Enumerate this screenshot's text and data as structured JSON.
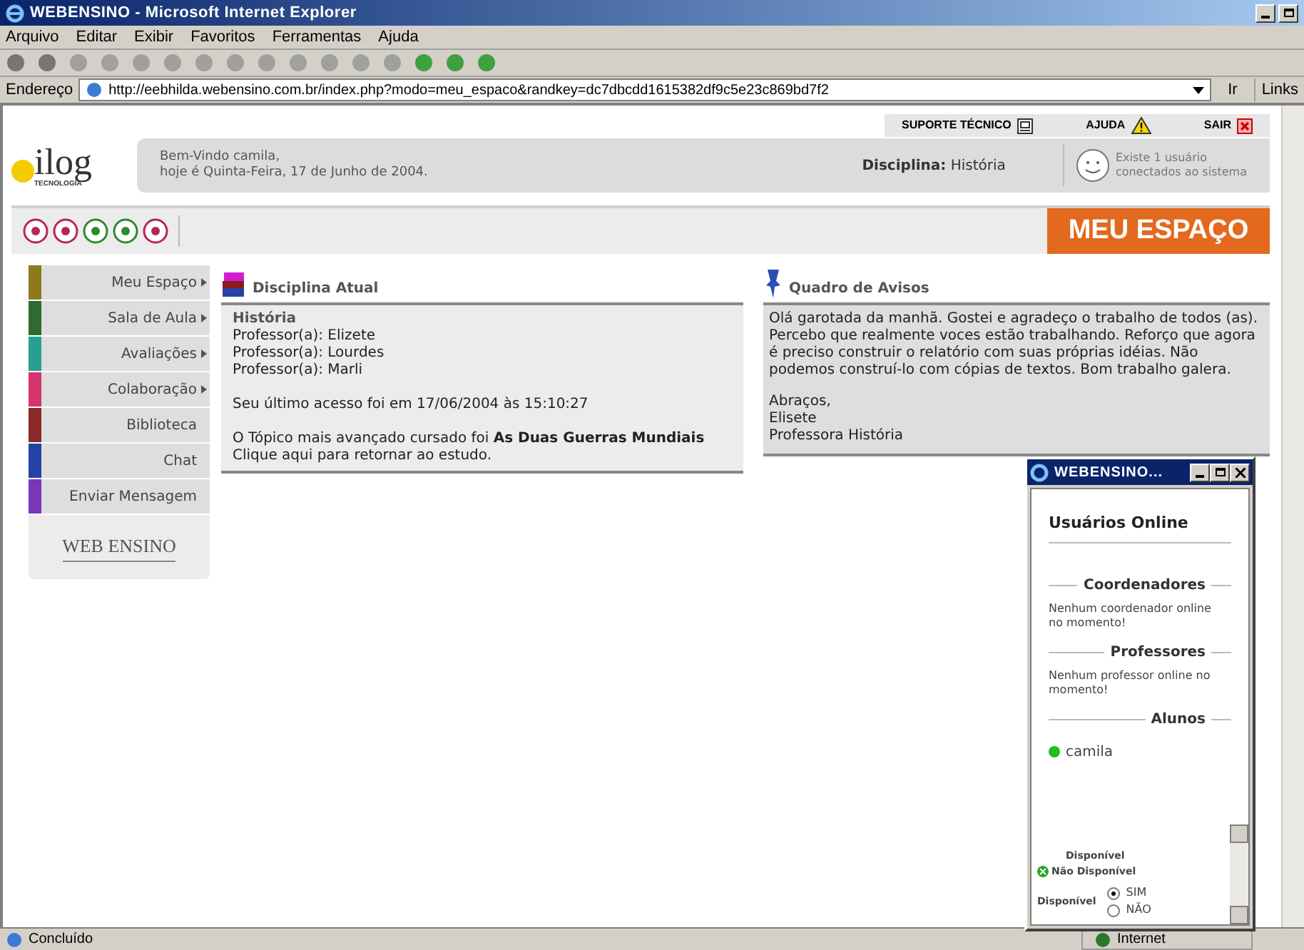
{
  "window": {
    "title": "WEBENSINO - Microsoft Internet Explorer"
  },
  "menu_bar": [
    "Arquivo",
    "Editar",
    "Exibir",
    "Favoritos",
    "Ferramentas",
    "Ajuda"
  ],
  "address_bar": {
    "label": "Endereço",
    "url": "http://eebhilda.webensino.com.br/index.php?modo=meu_espaco&randkey=dc7dbcdd1615382df9c5e23c869bd7f2",
    "go": "Ir",
    "links": "Links"
  },
  "top_links": [
    {
      "label": "SUPORTE TÉCNICO",
      "kind": "monitor"
    },
    {
      "label": "AJUDA",
      "kind": "warning"
    },
    {
      "label": "SAIR",
      "kind": "close"
    }
  ],
  "header": {
    "logo": "ilog",
    "logo_sub": "TECNOLOGIA",
    "welcome": "Bem-Vindo camila,",
    "date": "hoje é Quinta-Feira, 17 de Junho de 2004.",
    "discipline_label": "Disciplina:",
    "discipline_value": "História",
    "users_line1": "Existe 1 usuário",
    "users_line2": "conectados ao sistema"
  },
  "page_title": "MEU ESPAÇO",
  "sidebar": {
    "items": [
      {
        "label": "Meu Espaço",
        "color": "#8b7a1e",
        "submenu": true
      },
      {
        "label": "Sala de Aula",
        "color": "#2f6b2f",
        "submenu": true
      },
      {
        "label": "Avaliações",
        "color": "#27a093",
        "submenu": true
      },
      {
        "label": "Colaboração",
        "color": "#d6336f",
        "submenu": true
      },
      {
        "label": "Biblioteca",
        "color": "#8b2a2a",
        "submenu": false
      },
      {
        "label": "Chat",
        "color": "#2343a6",
        "submenu": false
      },
      {
        "label": "Enviar Mensagem",
        "color": "#7a35b8",
        "submenu": false
      }
    ],
    "brand": "WEB ENSINO"
  },
  "disciplina": {
    "title": "Disciplina Atual",
    "subject": "História",
    "professors": [
      "Professor(a): Elizete",
      "Professor(a): Lourdes",
      "Professor(a): Marli"
    ],
    "last_access": "Seu último acesso foi em 17/06/2004 às 15:10:27",
    "topic": "O Tópico mais avançado cursado foi **As Duas Guerras Mundiais**",
    "return_link": "Clique aqui para retornar ao estudo."
  },
  "avisos": {
    "title": "Quadro de Avisos",
    "message": "Olá garotada da manhã. Gostei e agradeço o trabalho de todos (as). Percebo que realmente voces estão trabalhando. Reforço que agora é preciso construir o relatório com suas próprias idéias. Não podemos construí-lo com cópias de textos. Bom trabalho galera.",
    "signature": [
      "Abraços,",
      "Elisete",
      "Professora História"
    ]
  },
  "popup": {
    "title": "WEBENSINO...",
    "heading": "Usuários Online",
    "sections": [
      {
        "title": "Coordenadores",
        "text": "Nenhum coordenador online no momento!"
      },
      {
        "title": "Professores",
        "text": "Nenhum professor online no momento!"
      },
      {
        "title": "Alunos",
        "users": [
          {
            "name": "camila",
            "color": "#22bb22"
          }
        ]
      }
    ],
    "legend": [
      "Disponível",
      "Não Disponível"
    ],
    "availability": {
      "label": "Disponível",
      "options": [
        {
          "label": "SIM",
          "selected": true
        },
        {
          "label": "NÃO",
          "selected": false
        }
      ]
    }
  },
  "status_bar": {
    "text": "Concluído",
    "zone": "Internet"
  }
}
